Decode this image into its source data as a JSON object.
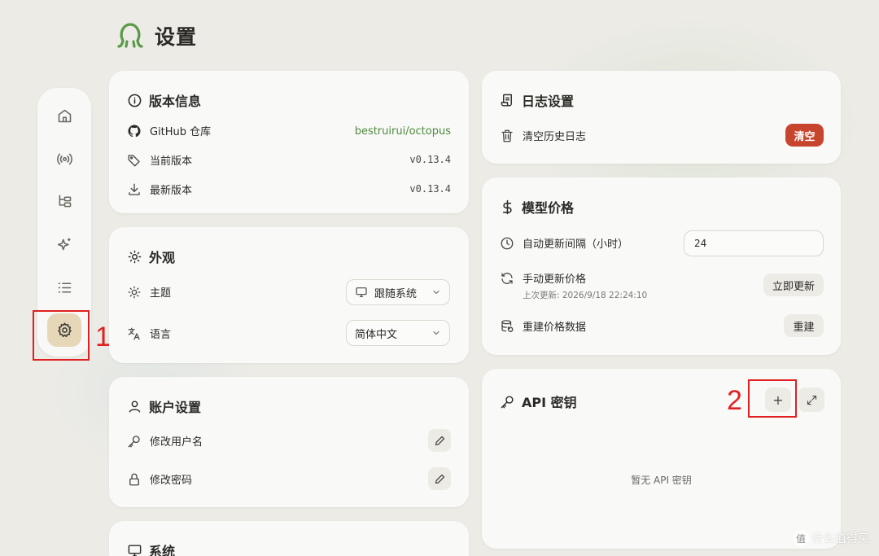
{
  "header": {
    "title": "设置",
    "logo_icon": "octopus-logo-icon"
  },
  "colors": {
    "accent": "#4f8a3e",
    "danger": "#c8452d",
    "active_nav": "#e6d7b8",
    "annotation": "#e02020"
  },
  "sidebar": {
    "items": [
      {
        "icon": "home-icon"
      },
      {
        "icon": "broadcast-icon"
      },
      {
        "icon": "hierarchy-icon"
      },
      {
        "icon": "sparkles-icon"
      },
      {
        "icon": "list-icon"
      },
      {
        "icon": "gear-icon",
        "active": true
      }
    ]
  },
  "annotations": {
    "one": "1",
    "two": "2"
  },
  "version_card": {
    "title": "版本信息",
    "repo_label": "GitHub 仓库",
    "repo_value": "bestruirui/octopus",
    "current_label": "当前版本",
    "current_value": "v0.13.4",
    "latest_label": "最新版本",
    "latest_value": "v0.13.4"
  },
  "appearance_card": {
    "title": "外观",
    "theme_label": "主题",
    "theme_value": "跟随系统",
    "language_label": "语言",
    "language_value": "简体中文"
  },
  "account_card": {
    "title": "账户设置",
    "username_label": "修改用户名",
    "password_label": "修改密码"
  },
  "system_card": {
    "title": "系统"
  },
  "log_card": {
    "title": "日志设置",
    "clear_label": "清空历史日志",
    "clear_button": "清空"
  },
  "price_card": {
    "title": "模型价格",
    "interval_label": "自动更新间隔（小时）",
    "interval_value": "24",
    "manual_label": "手动更新价格",
    "last_update": "上次更新: 2026/9/18 22:24:10",
    "update_button": "立即更新",
    "rebuild_label": "重建价格数据",
    "rebuild_button": "重建"
  },
  "api_card": {
    "title": "API 密钥",
    "add_button": "+",
    "empty_text": "暂无 API 密钥"
  },
  "watermark": {
    "text": "什么值得买",
    "badge": "值"
  }
}
